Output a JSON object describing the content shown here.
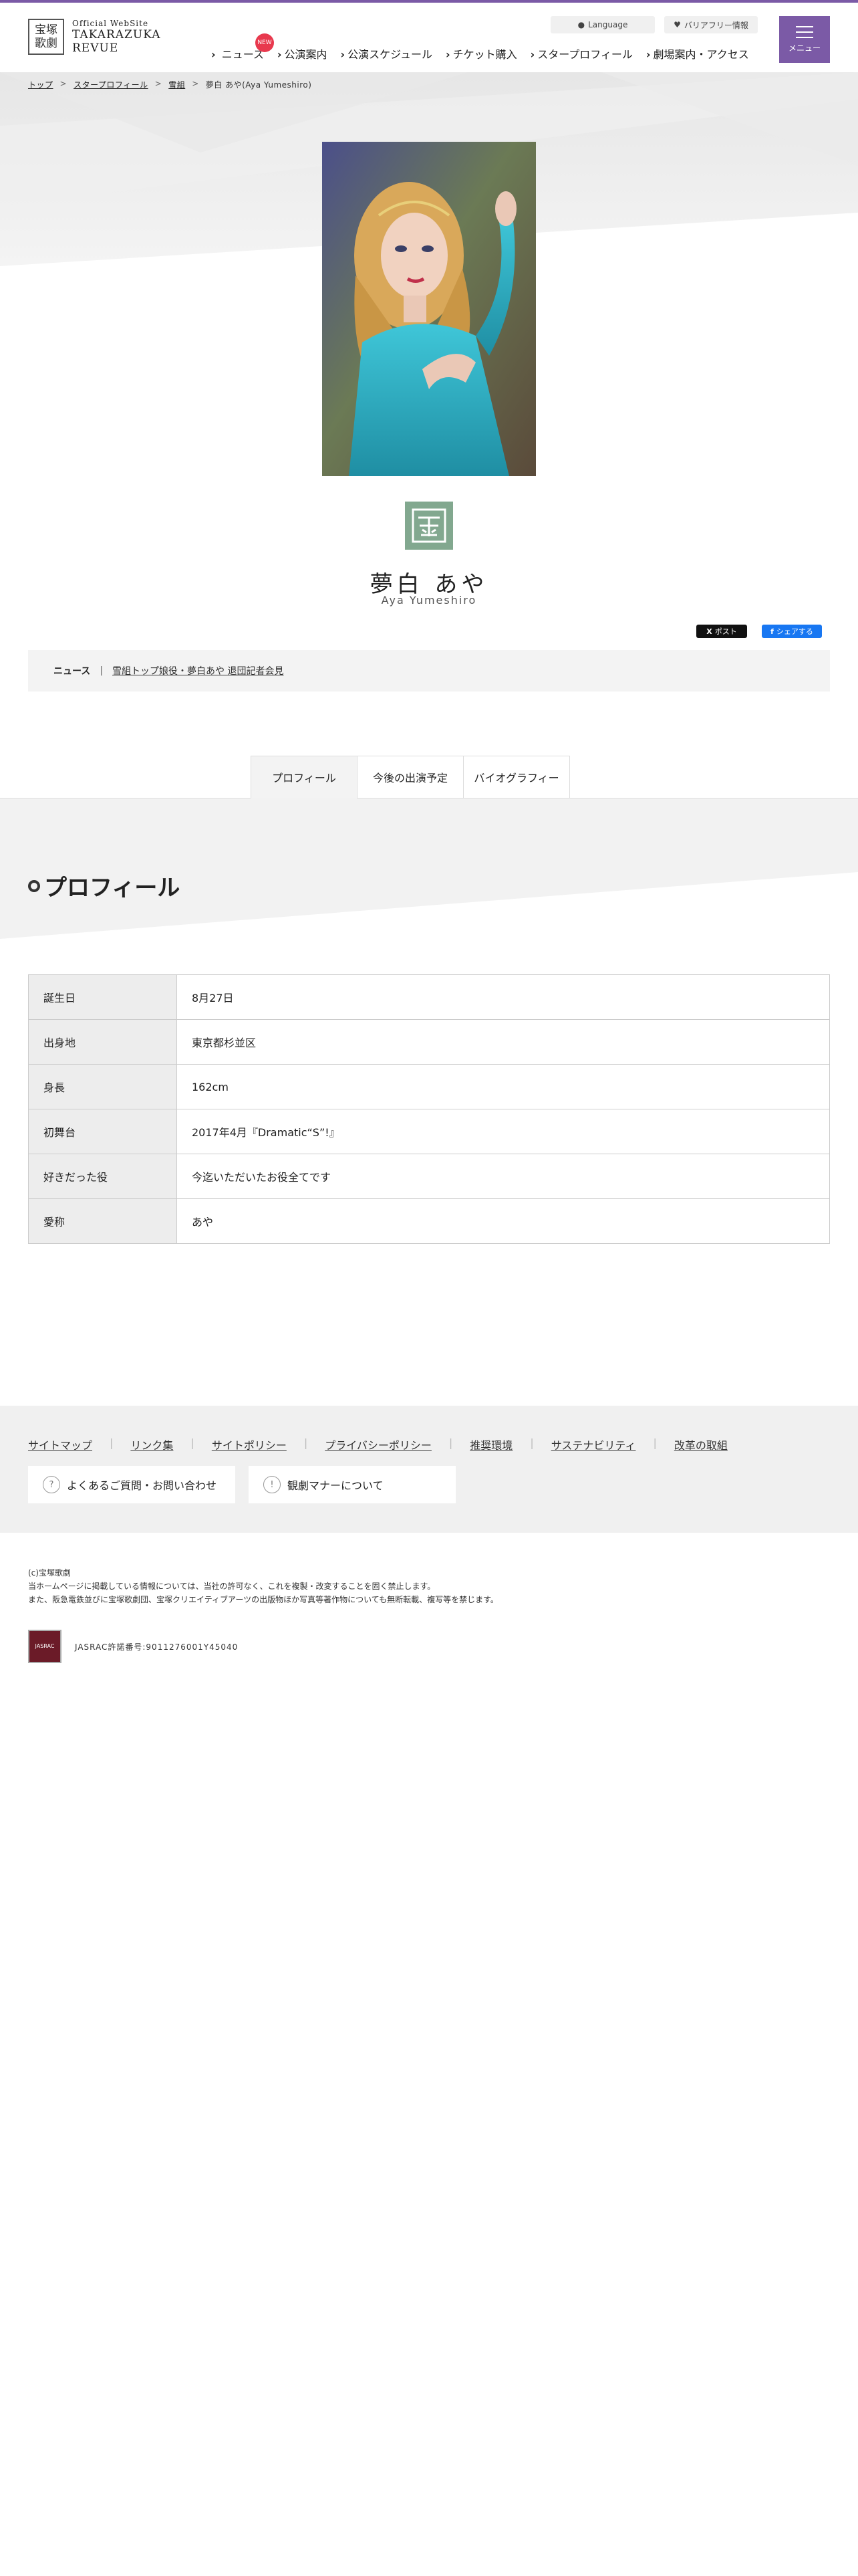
{
  "header": {
    "logo_kanji_top": "宝塚",
    "logo_kanji_bottom": "歌劇",
    "logo_official": "Official WebSite",
    "logo_name_1": "TAKARAZUKA",
    "logo_name_2": "REVUE",
    "language_label": "Language",
    "barrier_free_label": "バリアフリー情報",
    "menu_label": "メニュー",
    "accent_color": "#7b5aa6"
  },
  "gnav": {
    "items": [
      "ニュース",
      "公演案内",
      "公演スケジュール",
      "チケット購入",
      "スタープロフィール",
      "劇場案内・アクセス"
    ],
    "new_badge": "NEW"
  },
  "breadcrumb": {
    "home": "トップ",
    "profiles": "スタープロフィール",
    "troupe": "雪組",
    "current": "夢白 あや(Aya Yumeshiro)",
    "sep": ">"
  },
  "profile": {
    "name_ja": "夢白 あや",
    "name_en": "Aya Yumeshiro",
    "troupe_color": "#82a88f"
  },
  "sns": {
    "post_label": "ポスト",
    "share_label": "シェアする"
  },
  "news": {
    "label": "ニュース",
    "sep": "|",
    "link": "雪組トップ娘役・夢白あや 退団記者会見"
  },
  "tabs": [
    "プロフィール",
    "今後の出演予定",
    "バイオグラフィー"
  ],
  "section_title": "プロフィール",
  "profile_table": [
    {
      "label": "誕生日",
      "value": "8月27日"
    },
    {
      "label": "出身地",
      "value": "東京都杉並区"
    },
    {
      "label": "身長",
      "value": "162cm"
    },
    {
      "label": "初舞台",
      "value": "2017年4月『Dramatic“S”!』"
    },
    {
      "label": "好きだった役",
      "value": "今迄いただいたお役全てです"
    },
    {
      "label": "愛称",
      "value": "あや"
    }
  ],
  "footer": {
    "links": [
      "サイトマップ",
      "リンク集",
      "サイトポリシー",
      "プライバシーポリシー",
      "推奨環境",
      "サステナビリティ",
      "改革の取組"
    ],
    "link_sep": "|",
    "faq_label": "よくあるご質問・お問い合わせ",
    "manners_label": "観劇マナーについて",
    "faq_icon": "?",
    "manners_icon": "!"
  },
  "copyright": {
    "line1": "(c)宝塚歌劇",
    "line2": "当ホームページに掲載している情報については、当社の許可なく、これを複製・改変することを固く禁止します。",
    "line3": "また、阪急電鉄並びに宝塚歌劇団、宝塚クリエイティブアーツの出版物ほか写真等著作物についても無断転載、複写等を禁じます。"
  },
  "jasrac": {
    "logo_text": "JASRAC",
    "number": "JASRAC許諾番号:9011276001Y45040"
  }
}
